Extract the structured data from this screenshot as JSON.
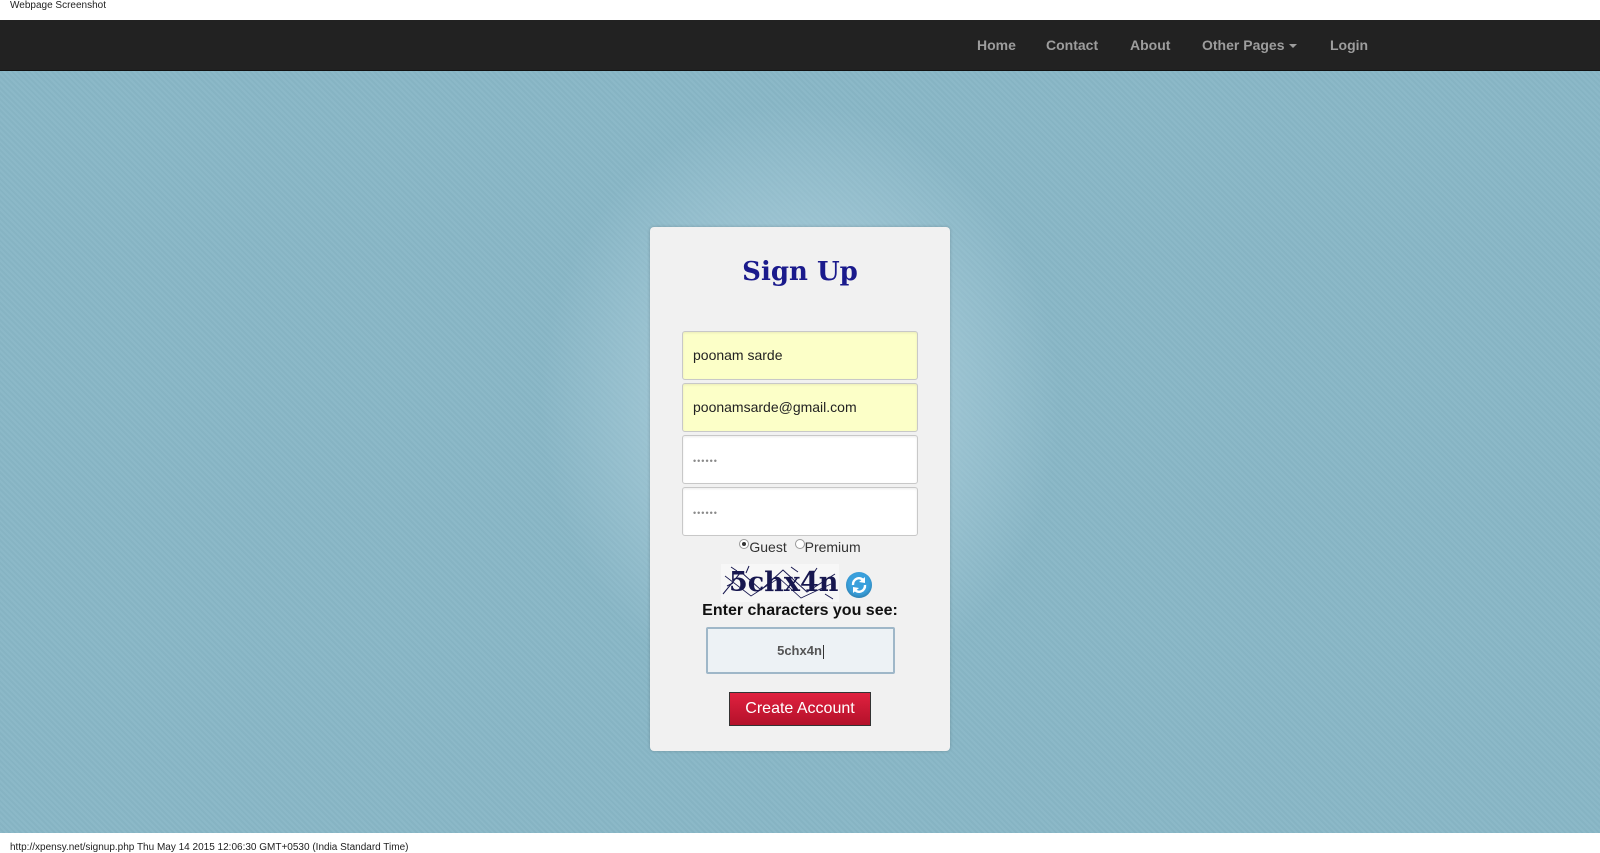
{
  "capture": {
    "header": "Webpage Screenshot",
    "footer": "http://xpensy.net/signup.php Thu May 14 2015 12:06:30 GMT+0530 (India Standard Time)"
  },
  "nav": {
    "home": "Home",
    "contact": "Contact",
    "about": "About",
    "other_pages": "Other Pages",
    "login": "Login"
  },
  "form": {
    "title": "Sign Up",
    "name_value": "poonam sarde",
    "email_value": "poonamsarde@gmail.com",
    "password_mask": "••••••",
    "confirm_mask": "••••••",
    "account_types": {
      "guest": "Guest",
      "premium": "Premium",
      "selected": "Guest"
    },
    "captcha_image_text": "5chx4n",
    "captcha_prompt": "Enter characters you see:",
    "captcha_value": "5chx4n",
    "submit_label": "Create Account"
  },
  "colors": {
    "navbar_bg": "#222222",
    "nav_text": "#9d9d9d",
    "page_bg": "#89b7c7",
    "title": "#1a1a8c",
    "autofill_bg": "#fcffc8",
    "submit_bg": "#c8182f",
    "refresh_icon": "#3aa0dc"
  }
}
